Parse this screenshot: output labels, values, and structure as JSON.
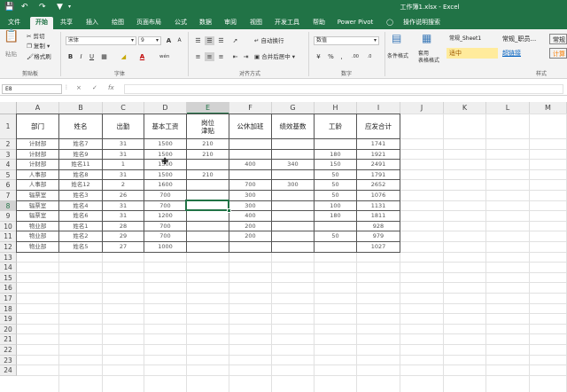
{
  "titlebar": {
    "save_icon": "save-icon",
    "undo_icon": "undo-icon",
    "redo_icon": "redo-icon",
    "filter_icon": "filter-icon",
    "title": "工作簿1.xlsx  -  Excel"
  },
  "tabs": [
    "文件",
    "开始",
    "共享",
    "插入",
    "绘图",
    "页面布局",
    "公式",
    "数据",
    "审阅",
    "视图",
    "开发工具",
    "帮助",
    "Power Pivot",
    "操作说明搜索"
  ],
  "active_tab": "开始",
  "ribbon": {
    "clipboard": {
      "paste": "粘贴",
      "cut": "剪切",
      "copy": "复制",
      "format_painter": "格式刷",
      "label": "剪贴板"
    },
    "font": {
      "name": "宋体",
      "size": "9",
      "bold": "B",
      "italic": "I",
      "underline": "U",
      "wen": "wén",
      "label": "字体",
      "grow": "A",
      "shrink": "A"
    },
    "alignment": {
      "wrap": "自动换行",
      "merge": "合并后居中",
      "label": "对齐方式"
    },
    "number": {
      "format": "数值",
      "label": "数字",
      "percent": "%",
      "comma": ",",
      "inc": ".00",
      "dec": ".0"
    },
    "styles": {
      "cond": "条件格式",
      "table": "套用\n表格格式",
      "style1": "常规_Sheet1",
      "style2": "常规_职员...",
      "style3": "常规",
      "mid": "适中",
      "link": "超链接",
      "calc": "计算",
      "label": "样式"
    }
  },
  "formula_bar": {
    "name_box": "E8",
    "cancel": "×",
    "enter": "✓",
    "fx": "fx",
    "value": ""
  },
  "colors": {
    "brand": "#217346",
    "selected_header": "#d2d2d2"
  },
  "columns": [
    "A",
    "B",
    "C",
    "D",
    "E",
    "F",
    "G",
    "H",
    "I",
    "J",
    "K",
    "L",
    "M"
  ],
  "rows": [
    "1",
    "2",
    "3",
    "4",
    "5",
    "6",
    "7",
    "8",
    "9",
    "10",
    "11",
    "12",
    "13",
    "14",
    "15",
    "16",
    "17",
    "18",
    "19",
    "20",
    "21",
    "22",
    "23",
    "24"
  ],
  "table": {
    "headers": [
      "部门",
      "姓名",
      "出勤",
      "基本工资",
      "岗位\n津贴",
      "公休加班",
      "绩效基数",
      "工龄",
      "应发合计"
    ],
    "rows": [
      [
        "计财部",
        "姓名7",
        "31",
        "1500",
        "210",
        "",
        "",
        "",
        "1741"
      ],
      [
        "计财部",
        "姓名9",
        "31",
        "1500",
        "210",
        "",
        "",
        "180",
        "1921"
      ],
      [
        "计财部",
        "姓名11",
        "1",
        "1500",
        "",
        "400",
        "340",
        "150",
        "2491"
      ],
      [
        "人事部",
        "姓名8",
        "31",
        "1500",
        "210",
        "",
        "",
        "50",
        "1791"
      ],
      [
        "人事部",
        "姓名12",
        "2",
        "1600",
        "",
        "700",
        "300",
        "50",
        "2652"
      ],
      [
        "辐票室",
        "姓名3",
        "26",
        "700",
        "",
        "300",
        "",
        "50",
        "1076"
      ],
      [
        "辐票室",
        "姓名4",
        "31",
        "700",
        "",
        "300",
        "",
        "100",
        "1131"
      ],
      [
        "辐票室",
        "姓名6",
        "31",
        "1200",
        "",
        "400",
        "",
        "180",
        "1811"
      ],
      [
        "物业部",
        "姓名1",
        "28",
        "700",
        "",
        "200",
        "",
        "",
        "928"
      ],
      [
        "物业部",
        "姓名2",
        "29",
        "700",
        "",
        "200",
        "",
        "50",
        "979"
      ],
      [
        "物业部",
        "姓名5",
        "27",
        "1000",
        "",
        "",
        "",
        "",
        "1027"
      ]
    ]
  }
}
